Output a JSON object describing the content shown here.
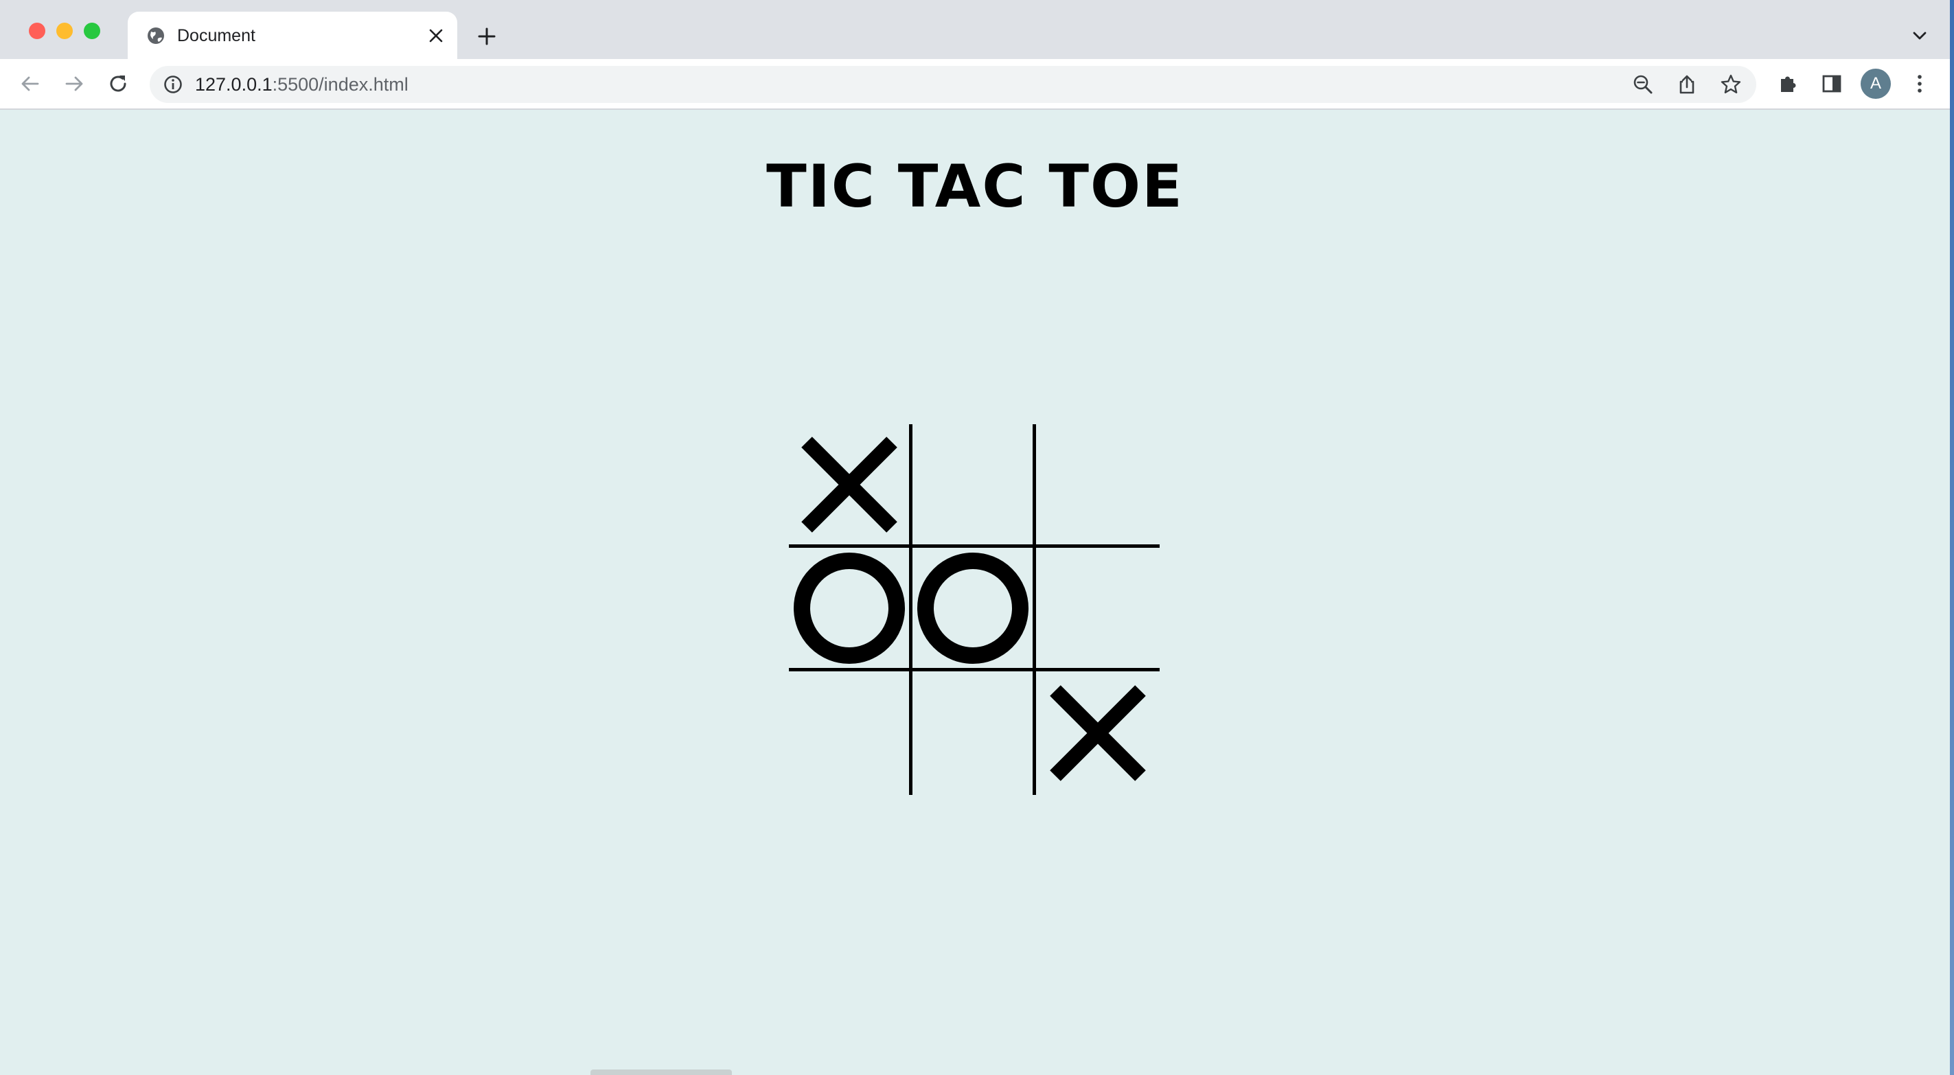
{
  "browser": {
    "tab": {
      "title": "Document",
      "icon": "globe-icon"
    },
    "address": {
      "host": "127.0.0.1",
      "path": ":5500/index.html"
    },
    "profile_initial": "A",
    "icons": {
      "back": "arrow-left-icon",
      "forward": "arrow-right-icon",
      "reload": "reload-icon",
      "info": "info-icon",
      "zoom": "zoom-out-icon",
      "share": "share-icon",
      "bookmark": "star-icon",
      "extensions": "puzzle-icon",
      "side_panel": "side-panel-icon",
      "menu": "kebab-menu-icon",
      "new_tab": "plus-icon",
      "close_tab": "close-icon",
      "tab_search": "chevron-down-icon"
    },
    "colors": {
      "tabstrip": "#dee1e6",
      "toolbar": "#ffffff",
      "omnibox": "#f1f3f4"
    }
  },
  "page": {
    "title": "TIC TAC TOE",
    "background": "#e1efef",
    "board": [
      "X",
      "",
      "",
      "O",
      "O",
      "",
      "",
      "",
      "X"
    ]
  }
}
